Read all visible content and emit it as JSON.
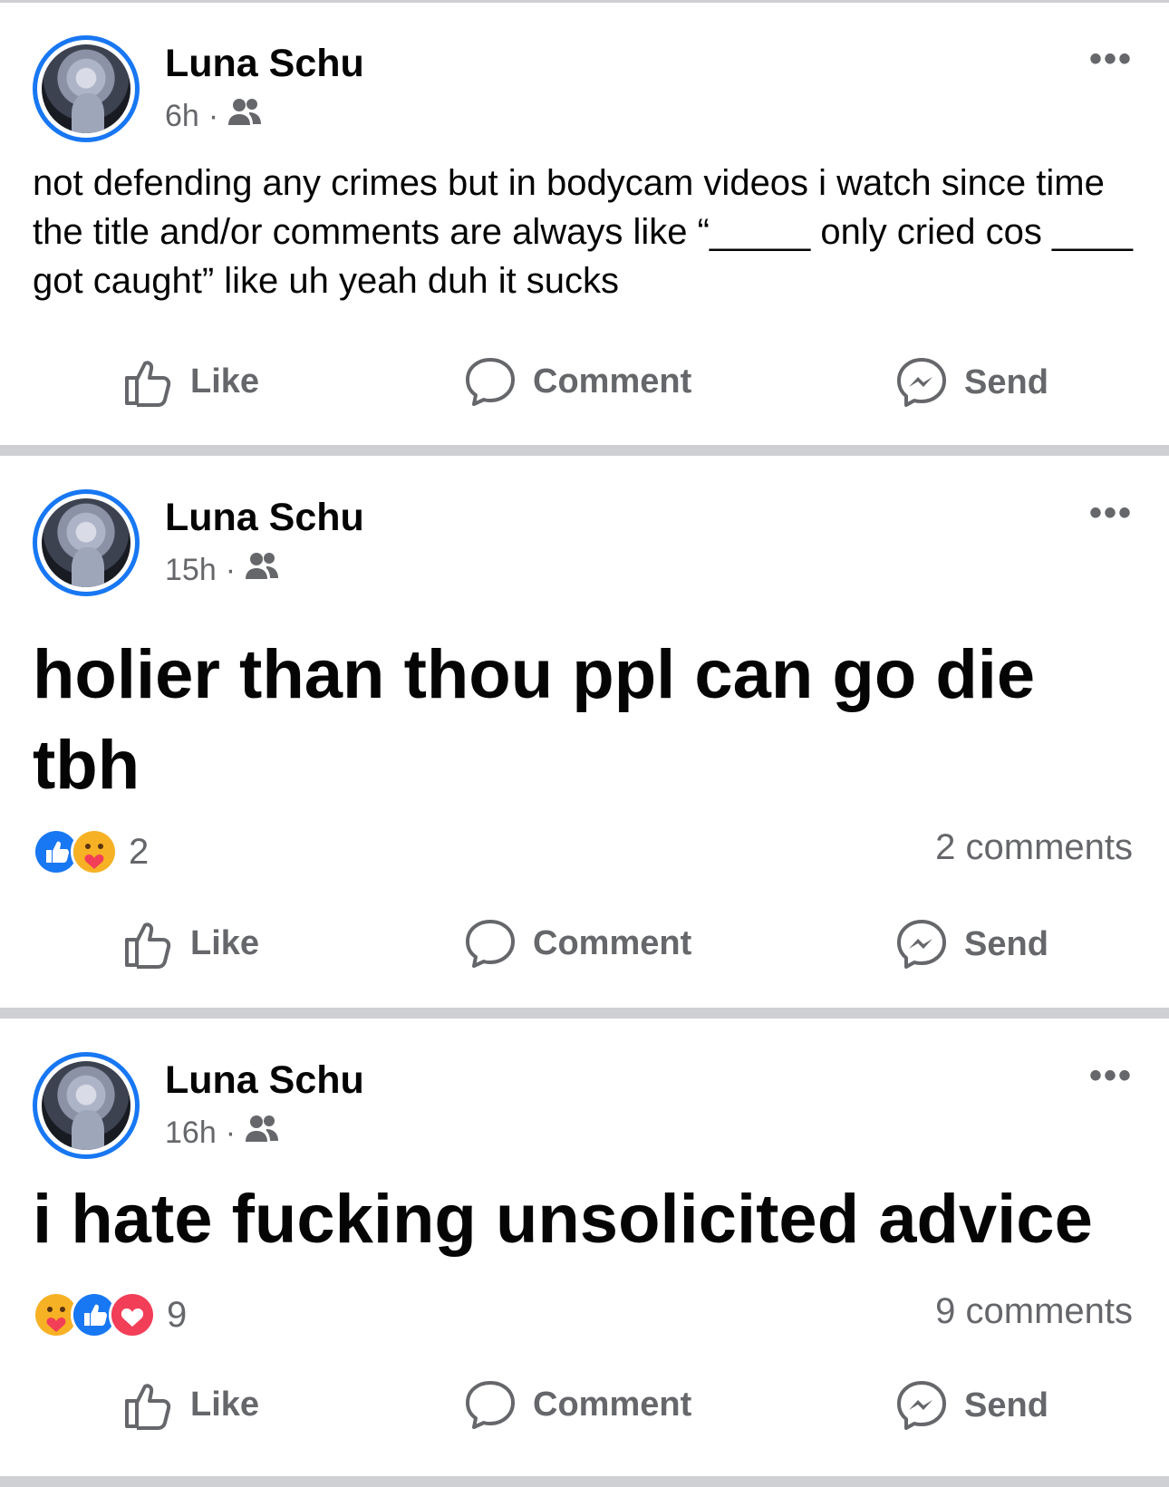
{
  "posts": [
    {
      "author": "Luna Schu",
      "time": "6h",
      "separator": "·",
      "audience_icon": "friends-icon",
      "text": "not defending any crimes but in bodycam videos i watch since time the title and/or comments are always like “_____ only cried cos ____ got caught” like uh yeah duh it sucks",
      "reactions": [],
      "reaction_count": "",
      "comments": "",
      "actions": {
        "like": "Like",
        "comment": "Comment",
        "send": "Send"
      }
    },
    {
      "author": "Luna Schu",
      "time": "15h",
      "separator": "·",
      "audience_icon": "friends-icon",
      "text": "holier than thou ppl can go die tbh",
      "reactions": [
        "like",
        "care"
      ],
      "reaction_count": "2",
      "comments": "2 comments",
      "actions": {
        "like": "Like",
        "comment": "Comment",
        "send": "Send"
      }
    },
    {
      "author": "Luna Schu",
      "time": "16h",
      "separator": "·",
      "audience_icon": "friends-icon",
      "text": "i hate fucking unsolicited advice",
      "reactions": [
        "care",
        "like",
        "love"
      ],
      "reaction_count": "9",
      "comments": "9 comments",
      "actions": {
        "like": "Like",
        "comment": "Comment",
        "send": "Send"
      }
    }
  ],
  "colors": {
    "accent": "#1877f2",
    "muted": "#65676b",
    "divider": "#ced0d4",
    "love": "#f33e58",
    "care": "#f7b125"
  }
}
